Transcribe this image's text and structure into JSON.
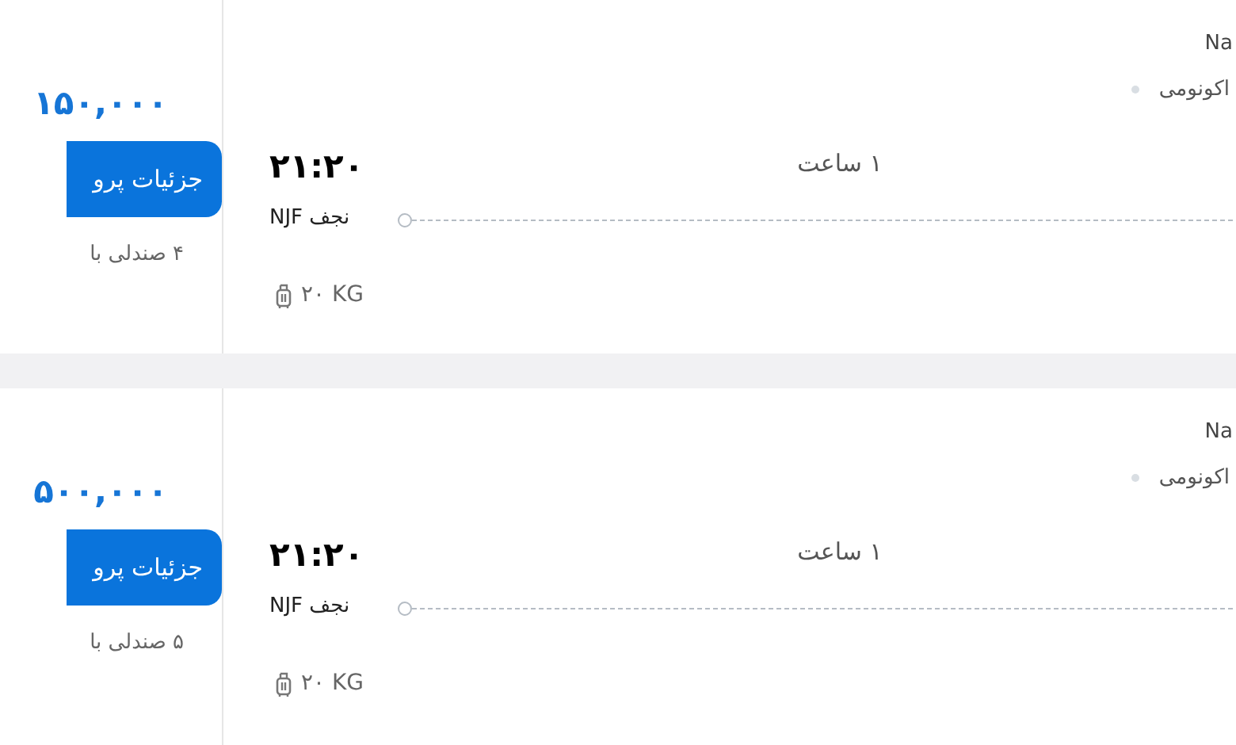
{
  "flights": [
    {
      "price": "۱۵۰,۰۰۰",
      "details_button": "جزئیات پرو",
      "seats": "۴ صندلی با",
      "carrier": "Na",
      "cabin": "اکونومی",
      "departure_time": "۲۱:۲۰",
      "departure_city": "نجف NJF",
      "duration": "۱ ساعت",
      "baggage": "۲۰ KG"
    },
    {
      "price": "۵۰۰,۰۰۰",
      "details_button": "جزئیات پرو",
      "seats": "۵ صندلی با",
      "carrier": "Na",
      "cabin": "اکونومی",
      "departure_time": "۲۱:۲۰",
      "departure_city": "نجف NJF",
      "duration": "۱ ساعت",
      "baggage": "۲۰ KG"
    }
  ]
}
